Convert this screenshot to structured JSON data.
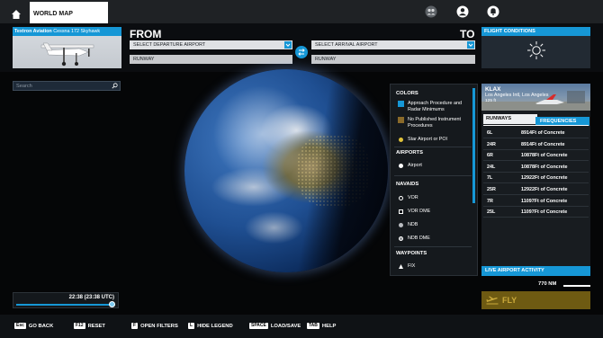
{
  "topbar": {
    "tab_label": "WORLD MAP",
    "icons": [
      "home-icon",
      "community-icon",
      "profile-icon",
      "notification-icon"
    ]
  },
  "aircraft": {
    "maker": "Textron Aviation",
    "model": "Cessna 172 Skyhawk"
  },
  "route": {
    "from_label": "FROM",
    "to_label": "TO",
    "departure_placeholder": "SELECT DEPARTURE AIRPORT",
    "arrival_placeholder": "SELECT ARRIVAL AIRPORT",
    "departure_runway": "RUNWAY",
    "arrival_runway": "RUNWAY"
  },
  "flight_conditions": {
    "title": "FLIGHT CONDITIONS",
    "weather_icon": "sun-icon"
  },
  "search": {
    "placeholder": "Search"
  },
  "legend": {
    "colors_title": "COLORS",
    "colors": [
      {
        "label": "Approach Procedure and Radar Minimums",
        "color": "#1697d6"
      },
      {
        "label": "No Published Instrument Procedures",
        "color": "#8a6a2a"
      },
      {
        "label": "Star Airport or POI",
        "color": "#e0c23a"
      }
    ],
    "airports_title": "AIRPORTS",
    "airports": [
      {
        "label": "Airport"
      }
    ],
    "navaids_title": "NAVAIDS",
    "navaids": [
      {
        "label": "VOR"
      },
      {
        "label": "VOR DME"
      },
      {
        "label": "NDB"
      },
      {
        "label": "NDB DME"
      }
    ],
    "waypoints_title": "WAYPOINTS",
    "waypoints": [
      {
        "label": "FIX"
      }
    ]
  },
  "airport": {
    "code": "KLAX",
    "name": "Los Angeles Intl, Los Angeles",
    "elevation": "125 ft",
    "tab_runways": "RUNWAYS",
    "tab_frequencies": "FREQUENCIES",
    "runways": [
      {
        "id": "6L",
        "length": "8914Ft of Concrete"
      },
      {
        "id": "24R",
        "length": "8914Ft of Concrete"
      },
      {
        "id": "6R",
        "length": "10878Ft of Concrete"
      },
      {
        "id": "24L",
        "length": "10878Ft of Concrete"
      },
      {
        "id": "7L",
        "length": "12922Ft of Concrete"
      },
      {
        "id": "25R",
        "length": "12922Ft of Concrete"
      },
      {
        "id": "7R",
        "length": "11097Ft of Concrete"
      },
      {
        "id": "25L",
        "length": "11097Ft of Concrete"
      }
    ],
    "live_traffic": "LIVE AIRPORT ACTIVITY"
  },
  "map": {
    "scale": "770 NM"
  },
  "fly": {
    "label": "FLY"
  },
  "time": {
    "value": "22:38 (23:38 UTC)",
    "progress": 0.97
  },
  "bottombar": [
    {
      "key": "Esc",
      "label": "GO BACK"
    },
    {
      "key": "F12",
      "label": "RESET"
    },
    {
      "key": "F",
      "label": "OPEN FILTERS"
    },
    {
      "key": "L",
      "label": "HIDE LEGEND"
    },
    {
      "key": "SPACE",
      "label": "LOAD/SAVE"
    },
    {
      "key": "TAB",
      "label": "HELP"
    }
  ],
  "colors": {
    "accent": "#1697d6",
    "fly_button": "#6e5a12",
    "fly_text": "#caa93a"
  }
}
